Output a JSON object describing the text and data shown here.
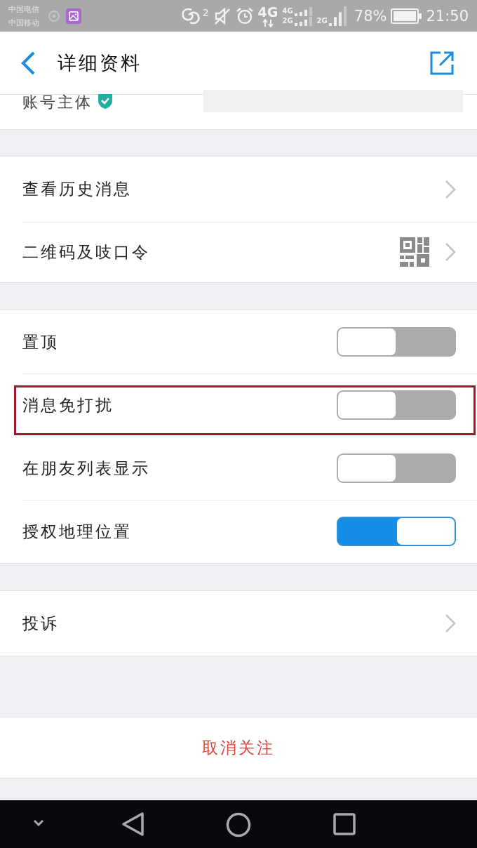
{
  "status_bar": {
    "carriers": [
      "中国电信",
      "中国移动"
    ],
    "badge": "2",
    "network": "4G",
    "signals": [
      {
        "kind": "stacked",
        "labels": [
          "4G",
          "2G"
        ]
      },
      {
        "kind": "single",
        "labels": [
          "2G"
        ]
      }
    ],
    "battery": "78%",
    "time": "21:50"
  },
  "header": {
    "title": "详细资料"
  },
  "account_row": {
    "label": "账号主体",
    "verified": true
  },
  "sections": [
    {
      "items": [
        {
          "kind": "link",
          "label": "查看历史消息"
        },
        {
          "kind": "qr",
          "label": "二维码及吱口令"
        }
      ]
    },
    {
      "items": [
        {
          "kind": "toggle",
          "label": "置顶",
          "on": false,
          "highlighted": false
        },
        {
          "kind": "toggle",
          "label": "消息免打扰",
          "on": false,
          "highlighted": true
        },
        {
          "kind": "toggle",
          "label": "在朋友列表显示",
          "on": false,
          "highlighted": false
        },
        {
          "kind": "toggle",
          "label": "授权地理位置",
          "on": true,
          "highlighted": false
        }
      ]
    },
    {
      "items": [
        {
          "kind": "link",
          "label": "投诉"
        }
      ]
    }
  ],
  "unfollow_button": {
    "label": "取消关注"
  }
}
